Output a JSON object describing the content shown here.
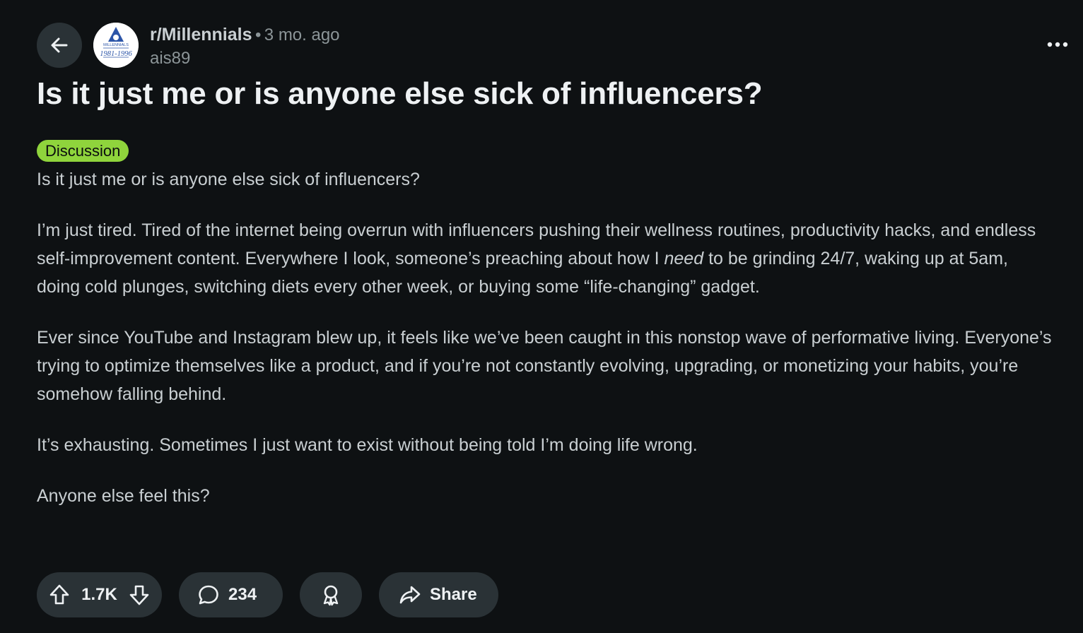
{
  "post": {
    "subreddit": "r/Millennials",
    "separator": "•",
    "time_ago": "3 mo. ago",
    "author": "ais89",
    "title": "Is it just me or is anyone else sick of influencers?",
    "flair": "Discussion",
    "avatar": {
      "top_text": "MILLENNIALS",
      "bottom_text": "1981-1996"
    },
    "body": {
      "p1": "Is it just me or is anyone else sick of influencers?",
      "p2_part1": "I’m just tired. Tired of the internet being overrun with influencers pushing their wellness routines, productivity hacks, and endless self-improvement content. Everywhere I look, someone’s preaching about how I ",
      "p2_emphasis": "need",
      "p2_part2": " to be grinding 24/7, waking up at 5am, doing cold plunges, switching diets every other week, or buying some “life-changing” gadget.",
      "p3": "Ever since YouTube and Instagram blew up, it feels like we’ve been caught in this nonstop wave of performative living. Everyone’s trying to optimize themselves like a product, and if you’re not constantly evolving, upgrading, or monetizing your habits, you’re somehow falling behind.",
      "p4": "It’s exhausting. Sometimes I just want to exist without being told I’m doing life wrong.",
      "p5": "Anyone else feel this?"
    }
  },
  "actions": {
    "score": "1.7K",
    "comments": "234",
    "share_label": "Share"
  },
  "icons": {
    "back": "arrow-left-icon",
    "more": "more-horizontal-icon",
    "upvote": "arrow-up-icon",
    "downvote": "arrow-down-icon",
    "comment": "speech-bubble-icon",
    "award": "award-icon",
    "share": "share-arrow-icon"
  },
  "colors": {
    "background": "#0e1113",
    "button_bg": "#2a3236",
    "flair_bg": "#8fd43c",
    "text_primary": "#eef1f3",
    "text_secondary": "#8c9598"
  }
}
